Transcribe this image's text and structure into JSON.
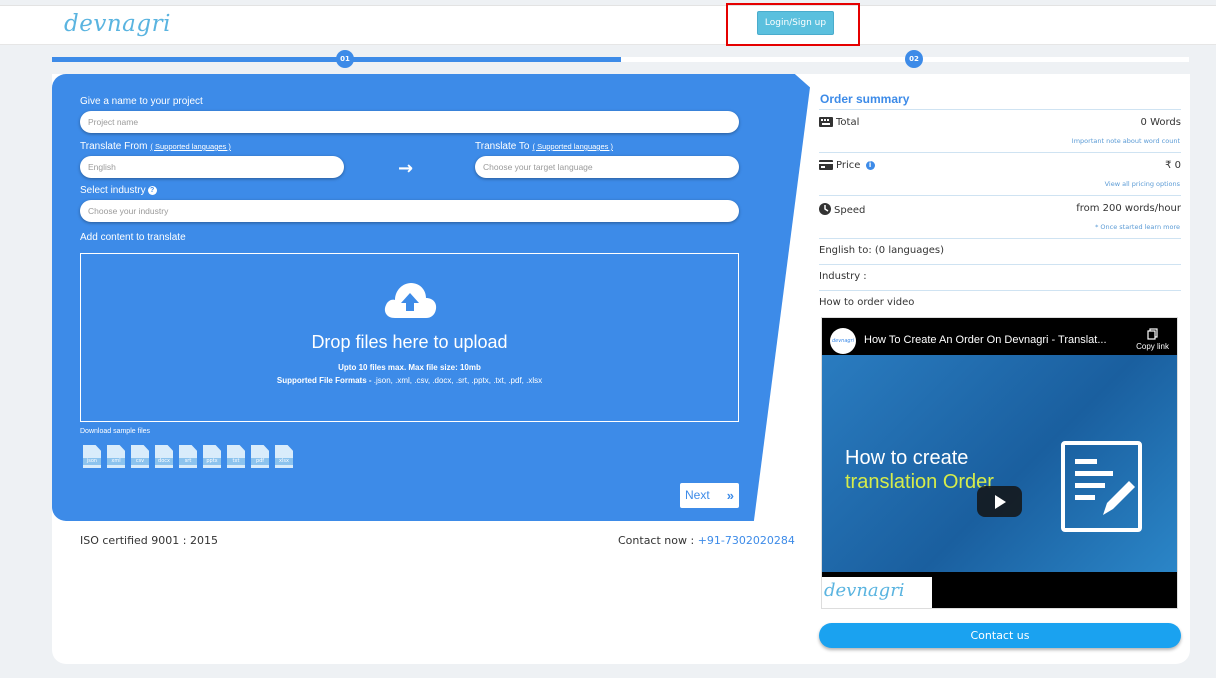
{
  "header": {
    "logo": "devnagri",
    "login_label": "Login/Sign up"
  },
  "steps": [
    "01",
    "02"
  ],
  "progress": {
    "step": 1,
    "total": 2
  },
  "form": {
    "project_label": "Give a name to your project",
    "project_placeholder": "Project name",
    "from_label": "Translate From",
    "from_link": "( Supported languages )",
    "from_value": "English",
    "to_label": "Translate To",
    "to_link": "( Supported languages )",
    "to_placeholder": "Choose your target language",
    "industry_label": "Select industry",
    "industry_placeholder": "Choose your industry",
    "content_label": "Add content to translate",
    "drop_title": "Drop files here to upload",
    "drop_sub": "Upto 10 files max. Max file size: 10mb",
    "formats_label": "Supported File Formats -",
    "formats": " .json, .xml, .csv, .docx, .srt, .pptx, .txt, .pdf, .xlsx",
    "samples_label": "Download sample files",
    "sample_files": [
      "json",
      "xml",
      "csv",
      "docx",
      "srt",
      "pptx",
      "txt",
      "pdf",
      "xlsx"
    ],
    "next_label": "Next",
    "next_icon": "»"
  },
  "footer": {
    "iso": "ISO certified 9001 : 2015",
    "contact_label": "Contact now :",
    "phone": "+91-7302020284"
  },
  "summary": {
    "title": "Order summary",
    "total_label": "Total",
    "total_value": "0 Words",
    "total_note": "Important note about word count",
    "price_label": "Price",
    "price_value": "₹ 0",
    "price_note": "View all pricing options",
    "speed_label": "Speed",
    "speed_value": "from 200 words/hour",
    "speed_note": "* Once started learn more",
    "english_to": "English to: (0 languages)",
    "industry": "Industry :",
    "video_label": "How to order video",
    "contact_btn": "Contact us"
  },
  "video": {
    "title": "How To Create An Order On Devnagri - Translat...",
    "copy_label": "Copy link",
    "channel_logo": "devnagri",
    "line1": "How to create",
    "line2": "translation Order",
    "brand": "devnagri"
  },
  "colors": {
    "primary": "#3d8be8",
    "login": "#5bc0de",
    "contact": "#1aa2f0",
    "highlight": "#e50000"
  }
}
